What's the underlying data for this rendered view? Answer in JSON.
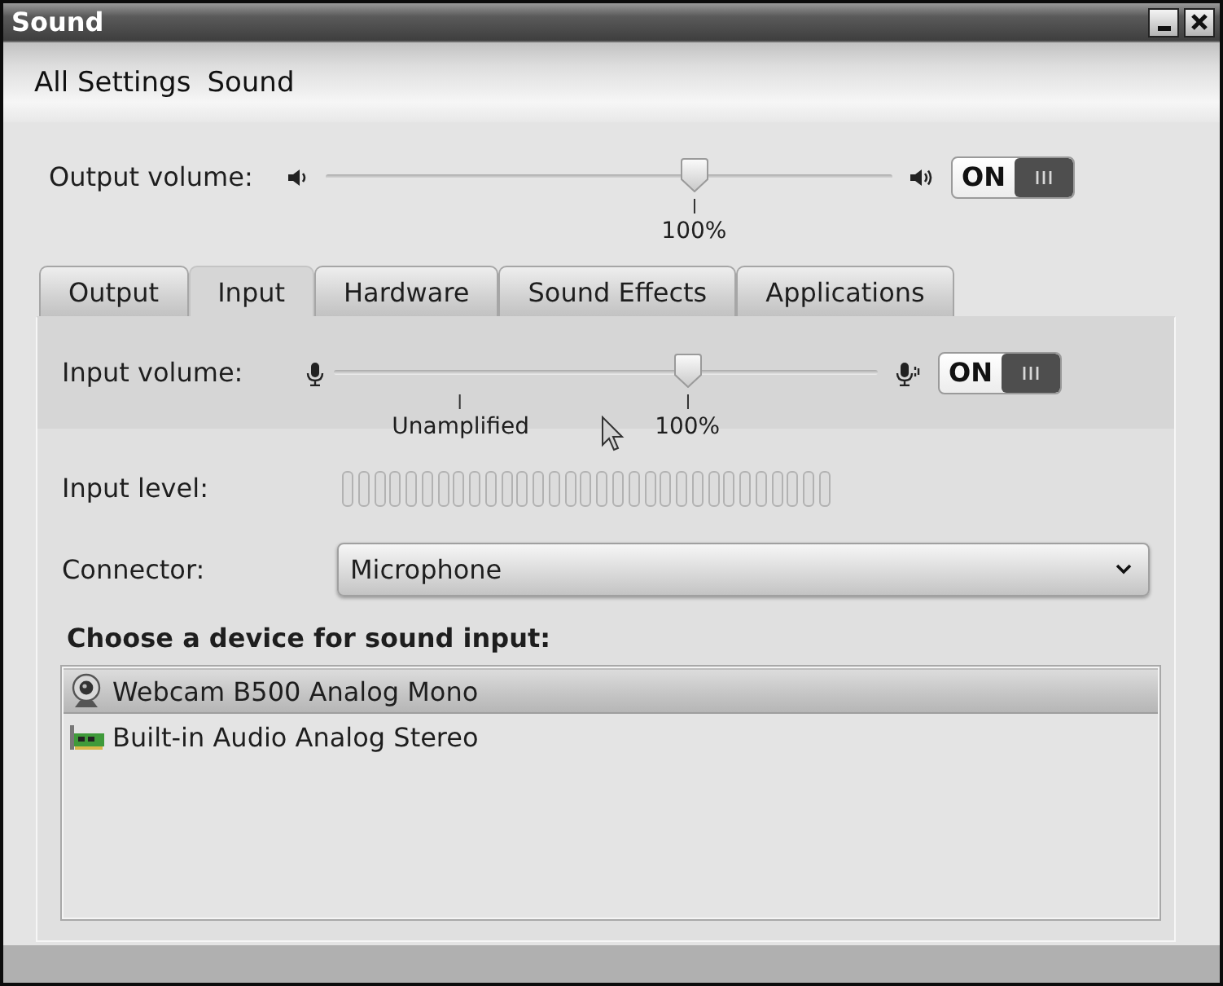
{
  "window": {
    "title": "Sound"
  },
  "breadcrumbs": [
    {
      "label": "All Settings"
    },
    {
      "label": "Sound"
    }
  ],
  "output_volume": {
    "label": "Output volume:",
    "level": 0.65,
    "marks": [
      {
        "label": "100%"
      }
    ],
    "switch": {
      "label": "ON",
      "on": true
    }
  },
  "tabs": [
    {
      "label": "Output",
      "selected": false
    },
    {
      "label": "Input",
      "selected": true
    },
    {
      "label": "Hardware",
      "selected": false
    },
    {
      "label": "Sound Effects",
      "selected": false
    },
    {
      "label": "Applications",
      "selected": false
    }
  ],
  "input": {
    "volume": {
      "label": "Input volume:",
      "level": 0.65,
      "marks": [
        {
          "label": "Unamplified"
        },
        {
          "label": "100%"
        }
      ],
      "switch": {
        "label": "ON",
        "on": true
      }
    },
    "input_level": {
      "label": "Input level:"
    },
    "connector": {
      "label": "Connector:",
      "value": "Microphone"
    },
    "device_heading": "Choose a device for sound input:",
    "devices": [
      {
        "name": "Webcam B500 Analog Mono",
        "kind": "webcam",
        "selected": true
      },
      {
        "name": "Built-in Audio Analog Stereo",
        "kind": "soundcard",
        "selected": false
      }
    ]
  }
}
